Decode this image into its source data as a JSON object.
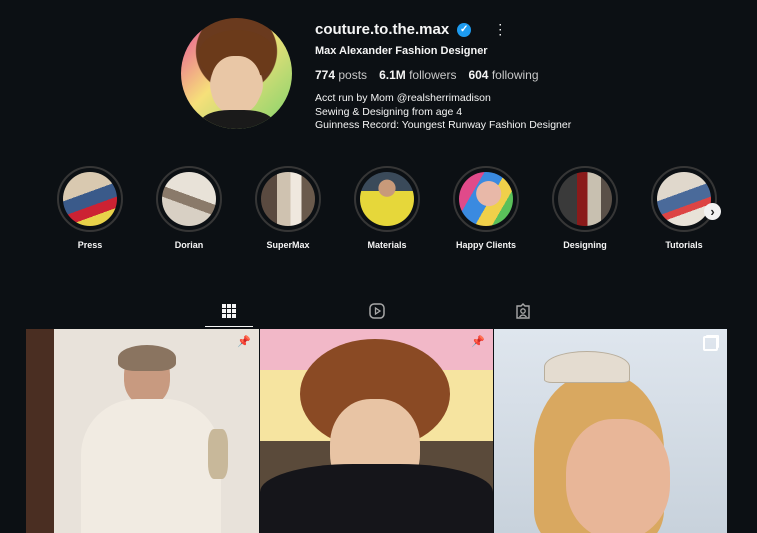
{
  "profile": {
    "username": "couture.to.the.max",
    "full_name": "Max Alexander Fashion Designer",
    "posts_count": "774",
    "posts_label": "posts",
    "followers_count": "6.1M",
    "followers_label": "followers",
    "following_count": "604",
    "following_label": "following",
    "bio": [
      "Acct run by Mom @realsherrimadison",
      "Sewing & Designing from age 4",
      "Guinness Record: Youngest Runway Fashion Designer"
    ]
  },
  "icons": {
    "verified": "verified-badge-icon",
    "more": "more-options-icon",
    "next": "chevron-right-icon",
    "posts_tab": "grid-icon",
    "reels_tab": "reels-play-icon",
    "tagged_tab": "tagged-user-icon",
    "pin": "pin-icon",
    "carousel": "carousel-icon"
  },
  "highlights": [
    {
      "label": "Press"
    },
    {
      "label": "Dorian"
    },
    {
      "label": "SuperMax"
    },
    {
      "label": "Materials"
    },
    {
      "label": "Happy Clients"
    },
    {
      "label": "Designing"
    },
    {
      "label": "Tutorials"
    }
  ],
  "colors": {
    "background": "#0c1014",
    "verified": "#1d9bf0",
    "ring": "#363636"
  }
}
